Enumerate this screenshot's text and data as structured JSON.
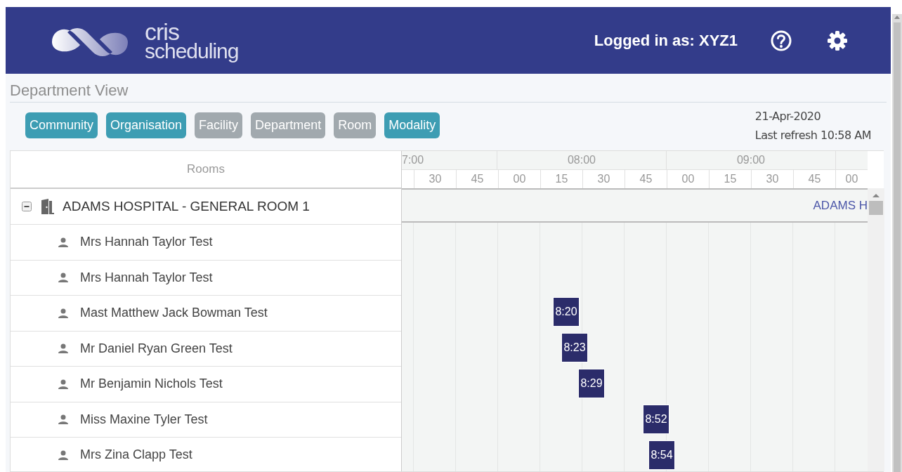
{
  "header": {
    "logo_line1": "cris",
    "logo_line2": "scheduling",
    "user": "Logged in as: XYZ1"
  },
  "page_title": "Department View",
  "filters": [
    {
      "label": "Community",
      "selected": true
    },
    {
      "label": "Organisation",
      "selected": true
    },
    {
      "label": "Facility",
      "selected": false
    },
    {
      "label": "Department",
      "selected": false
    },
    {
      "label": "Room",
      "selected": false
    },
    {
      "label": "Modality",
      "selected": true
    }
  ],
  "date": "21-Apr-2020",
  "last_refresh": "Last refresh 10:58 AM",
  "rooms_header": "Rooms",
  "hours": [
    "7:00",
    "08:00",
    "09:00"
  ],
  "minutes": [
    "30",
    "45",
    "00",
    "15",
    "30",
    "45",
    "00",
    "15",
    "30",
    "45",
    "00"
  ],
  "room": {
    "name": "ADAMS HOSPITAL - GENERAL ROOM 1",
    "expanded": true,
    "timeline_label": "ADAMS H"
  },
  "patients": [
    {
      "name": "Mrs Hannah Taylor Test"
    },
    {
      "name": "Mrs Hannah Taylor Test"
    },
    {
      "name": "Mast Matthew Jack Bowman Test",
      "appointment": "8:20"
    },
    {
      "name": "Mr Daniel Ryan Green Test",
      "appointment": "8:23"
    },
    {
      "name": "Mr Benjamin Nichols Test",
      "appointment": "8:29"
    },
    {
      "name": "Miss Maxine Tyler Test",
      "appointment": "8:52"
    },
    {
      "name": "Mrs Zina Clapp Test",
      "appointment": "8:54"
    }
  ]
}
